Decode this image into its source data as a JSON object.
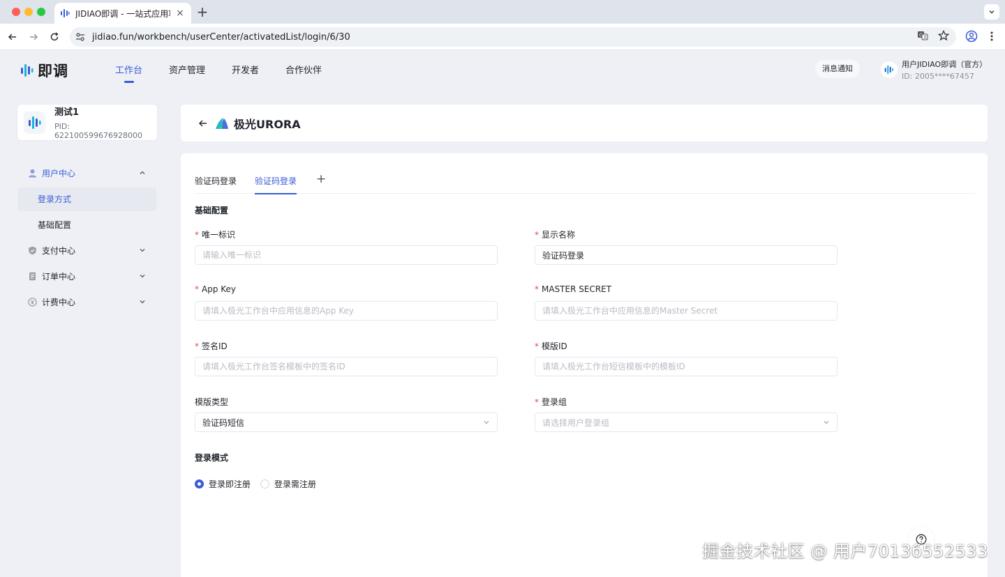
{
  "browser": {
    "tab_title": "JIDIAO即调 - 一站式应用项目全",
    "url": "jidiao.fun/workbench/userCenter/activatedList/login/6/30"
  },
  "header": {
    "logo_text": "即调",
    "nav": [
      "工作台",
      "资产管理",
      "开发者",
      "合作伙伴"
    ],
    "notify_label": "消息通知",
    "user_name": "用户JIDIAO即调（官方）",
    "user_id": "ID: 2005****67457"
  },
  "project": {
    "name": "测试1",
    "pid": "PID: 622100599676928000"
  },
  "sidebar": {
    "groups": [
      {
        "label": "用户中心",
        "sub": [
          "登录方式",
          "基础配置"
        ]
      },
      {
        "label": "支付中心"
      },
      {
        "label": "订单中心"
      },
      {
        "label": "计费中心"
      }
    ]
  },
  "title": "极光URORA",
  "tabs": [
    "验证码登录",
    "验证码登录"
  ],
  "sections": {
    "basic": "基础配置",
    "mode": "登录模式"
  },
  "fields": {
    "unique_id": {
      "label": "唯一标识",
      "placeholder": "请输入唯一标识",
      "value": ""
    },
    "display_name": {
      "label": "显示名称",
      "placeholder": "",
      "value": "验证码登录"
    },
    "app_key": {
      "label": "App Key",
      "placeholder": "请填入极光工作台中应用信息的App Key",
      "value": ""
    },
    "master_secret": {
      "label": "MASTER SECRET",
      "placeholder": "请填入极光工作台中应用信息的Master Secret",
      "value": ""
    },
    "sign_id": {
      "label": "签名ID",
      "placeholder": "请填入极光工作台签名模板中的签名ID",
      "value": ""
    },
    "template_id": {
      "label": "模版ID",
      "placeholder": "请填入极光工作台短信模板中的模板ID",
      "value": ""
    },
    "template_type": {
      "label": "模版类型",
      "value": "验证码短信"
    },
    "login_group": {
      "label": "登录组",
      "placeholder": "请选择用户登录组"
    }
  },
  "radio": {
    "options": [
      "登录即注册",
      "登录需注册"
    ],
    "selected": "登录即注册"
  },
  "watermark": "掘金技术社区 @ 用户7013б552533",
  "colors": {
    "accent": "#3a5bd9",
    "required": "#e5484d"
  }
}
